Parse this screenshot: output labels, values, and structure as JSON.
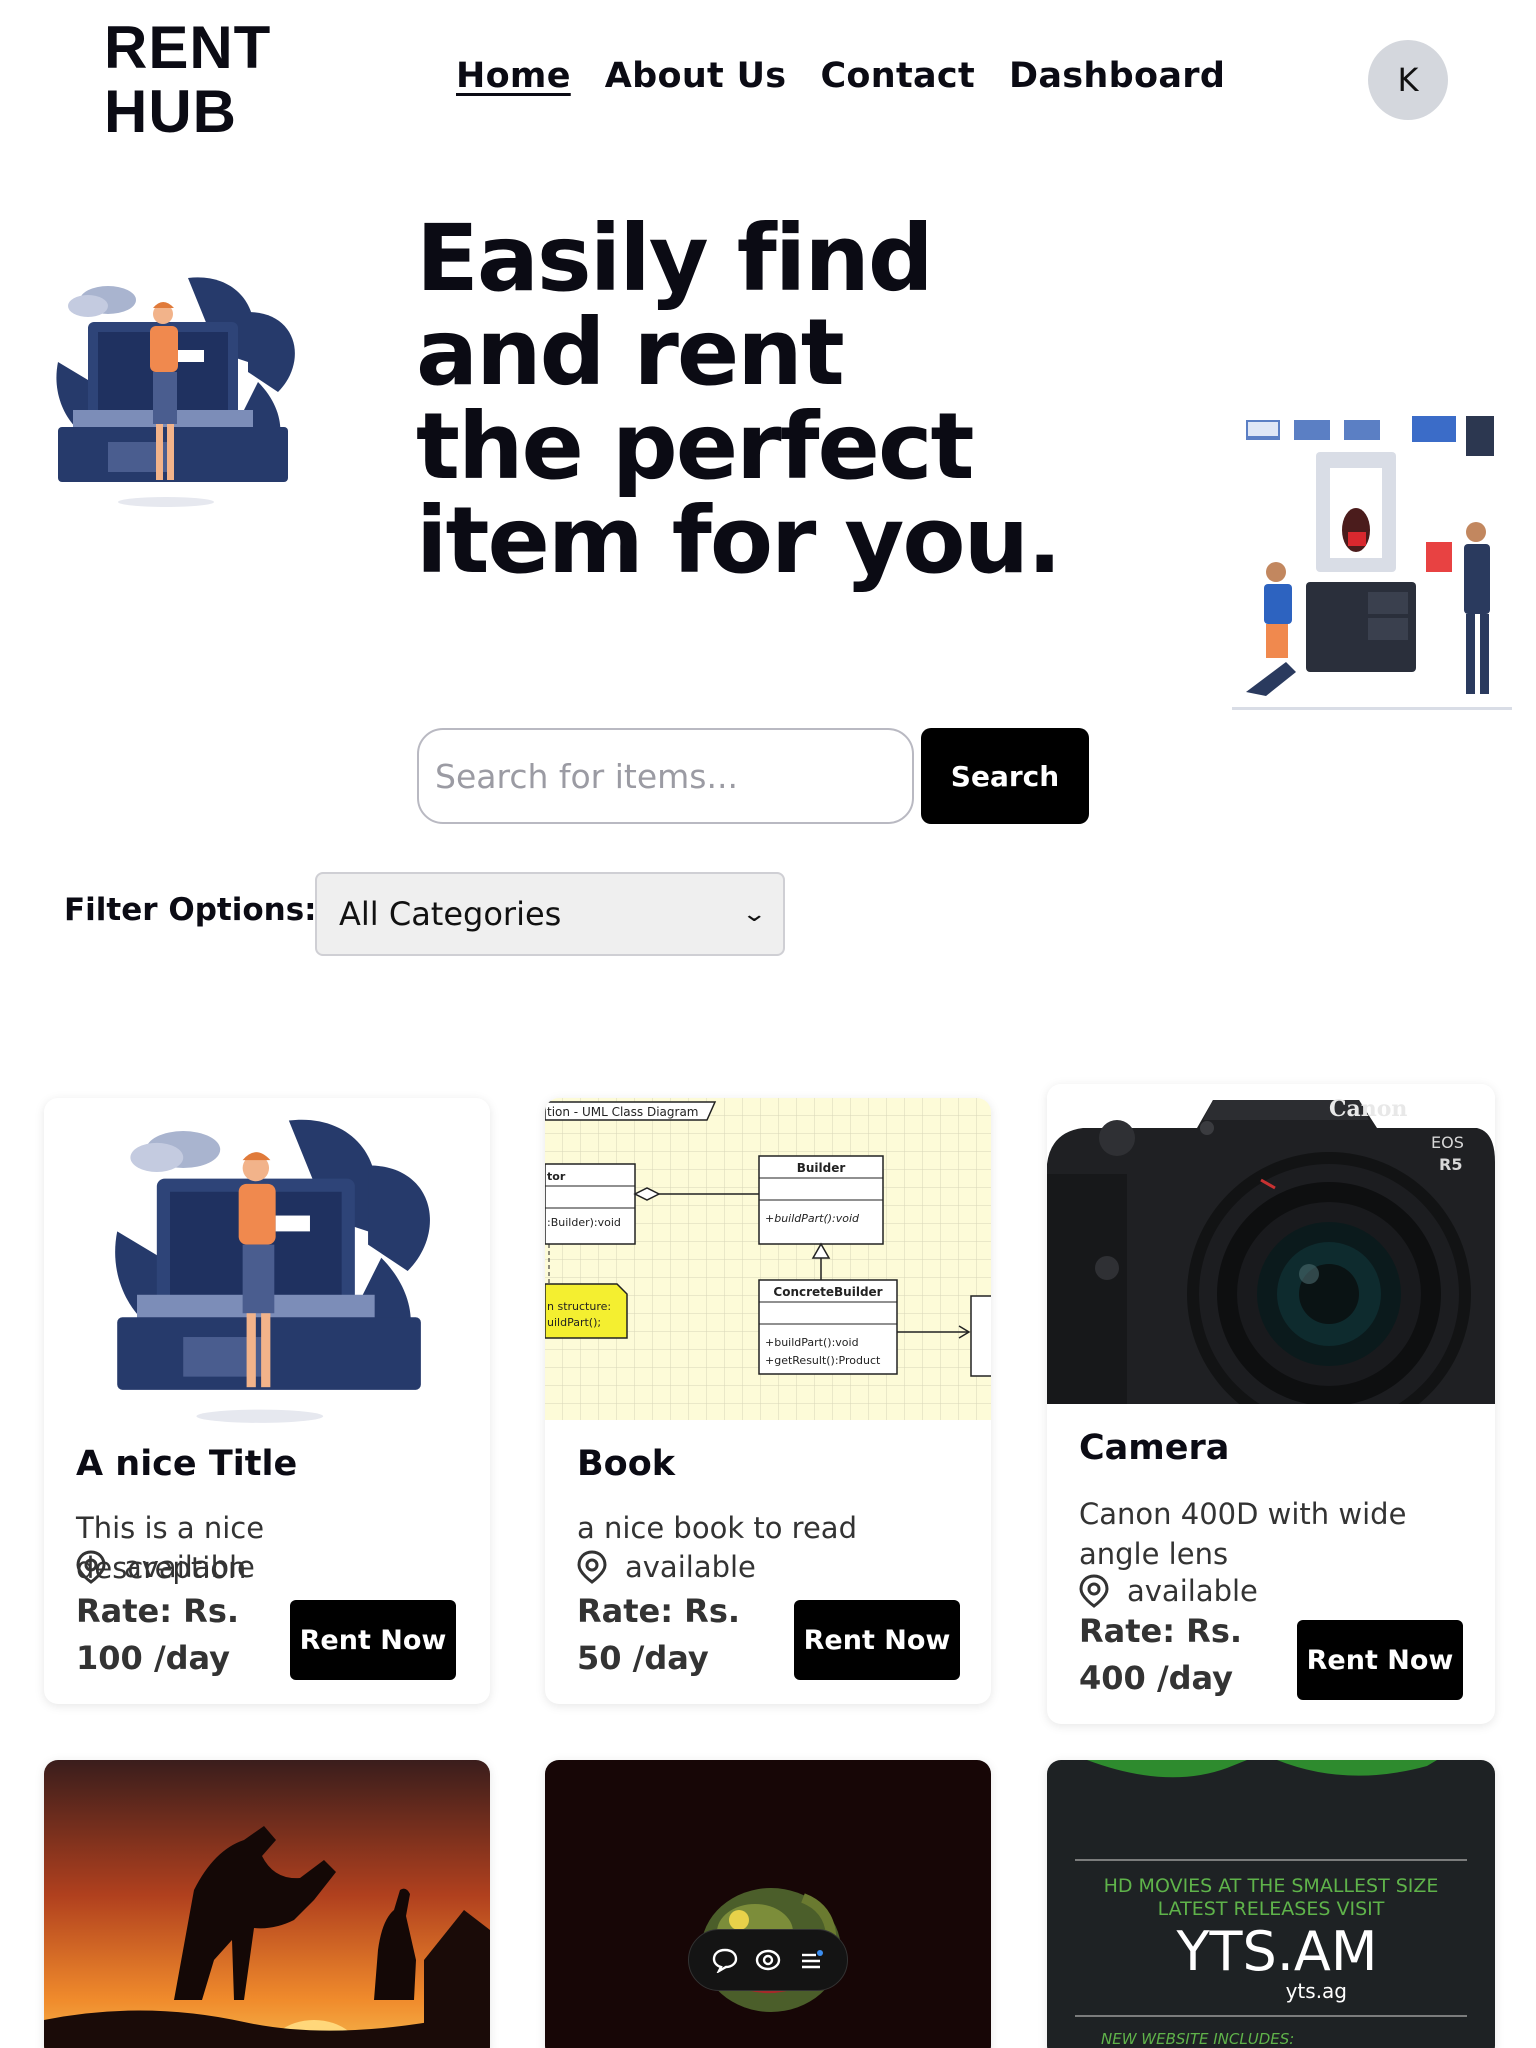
{
  "header": {
    "logo": "RENT HUB",
    "nav": [
      "Home",
      "About Us",
      "Contact",
      "Dashboard"
    ],
    "avatar_initial": "K"
  },
  "hero": {
    "title_lines": [
      "Easily find",
      "and rent",
      "the perfect",
      "item for you."
    ],
    "search_placeholder": "Search for items...",
    "search_button": "Search"
  },
  "filter": {
    "label": "Filter Options:",
    "selected": "All Categories"
  },
  "cards": [
    {
      "title": "A nice Title",
      "description": "This is a nice descreption",
      "status": "available",
      "rate": "Rate: Rs. 100 /day",
      "button": "Rent Now",
      "image": "person-laptop-illustration"
    },
    {
      "title": "Book",
      "description": "a nice book to read",
      "status": "available",
      "rate": "Rate: Rs. 50 /day",
      "button": "Rent Now",
      "image": "uml-class-diagram"
    },
    {
      "title": "Camera",
      "description": "Canon 400D with wide angle lens",
      "status": "available",
      "rate": "Rate: Rs. 400 /day",
      "button": "Rent Now",
      "image": "canon-camera"
    }
  ],
  "second_row_images": {
    "uml_caption": "tion - UML Class Diagram",
    "uml_builder": "Builder",
    "uml_builder_method": "+buildPart():void",
    "uml_concrete": "ConcreteBuilder",
    "uml_concrete_m1": "+buildPart():void",
    "uml_concrete_m2": "+getResult():Product",
    "uml_left_method": ":Builder):void",
    "uml_note1": "n structure:",
    "uml_note2": "uildPart();",
    "uml_left_top": "tor",
    "camera_brand": "Canon",
    "camera_model1": "EOS",
    "camera_model2": "R5",
    "yts_line1": "HD MOVIES AT THE SMALLEST SIZE",
    "yts_line2": "LATEST RELEASES VISIT",
    "yts_main": "YTS.AM",
    "yts_sub": "yts.ag",
    "yts_bottom": "NEW WEBSITE INCLUDES:"
  },
  "colors": {
    "primary": "#000000",
    "text": "#0b0b14",
    "navy": "#263a6b",
    "orange": "#f0894e"
  }
}
